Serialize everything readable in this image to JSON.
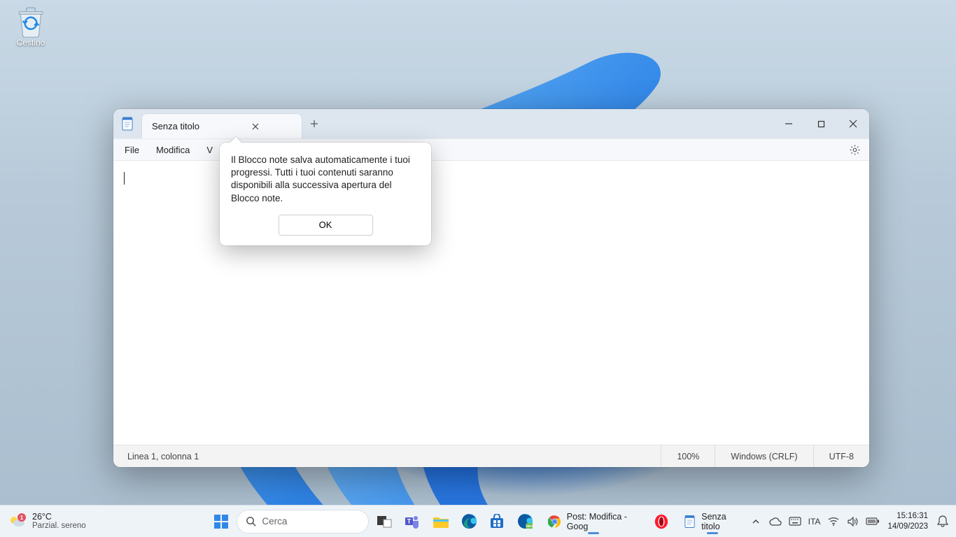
{
  "desktop": {
    "recycle_bin_label": "Cestino"
  },
  "notepad": {
    "tab_title": "Senza titolo",
    "menu": {
      "file": "File",
      "edit": "Modifica",
      "view": "V"
    },
    "tooltip": {
      "text": "Il Blocco note salva automaticamente i tuoi progressi. Tutti i tuoi contenuti saranno disponibili alla successiva apertura del Blocco note.",
      "ok": "OK"
    },
    "status": {
      "position": "Linea 1, colonna 1",
      "zoom": "100%",
      "line_endings": "Windows (CRLF)",
      "encoding": "UTF-8"
    }
  },
  "taskbar": {
    "weather": {
      "temp": "26°C",
      "desc": "Parzial. sereno",
      "badge": "1"
    },
    "search_placeholder": "Cerca",
    "apps": {
      "chrome_label": "Post: Modifica - Goog",
      "notepad_label": "Senza titolo"
    },
    "tray": {
      "lang": "ITA",
      "time": "15:16:31",
      "date": "14/09/2023"
    }
  }
}
